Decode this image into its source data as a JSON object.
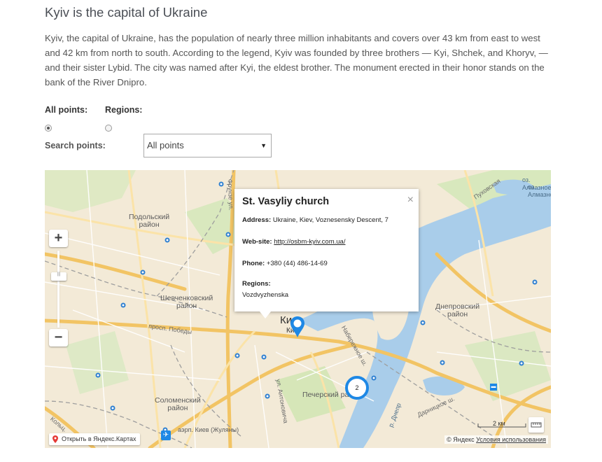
{
  "page": {
    "title": "Kyiv is the capital of Ukraine",
    "intro": "Kyiv, the capital of Ukraine, has the population of nearly three million inhabitants and covers over 43 km from east to west and 42 km from north to south. According to the legend, Kyiv was founded by three brothers — Kyi, Shchek, and Khoryv, — and their sister Lybid. The city was named after Kyi, the eldest brother. The monument erected in their honor stands on the bank of the River Dnipro."
  },
  "filters": {
    "all_points_label": "All points:",
    "regions_label": "Regions:",
    "selected": "all_points",
    "search_label": "Search points:",
    "search_value": "All points"
  },
  "map": {
    "zoom_in": "+",
    "zoom_out": "−",
    "labels": {
      "podolsky": "Подольский\nрайон",
      "shevchenkovsky": "Шевченковский\nрайон",
      "dneprovsky": "Днепровский\nрайон",
      "pechersky": "Печерский район",
      "solomensky": "Соломенский\nрайон",
      "kyiv": "Киев",
      "kyiv_sub": "Київ",
      "airport": "аэрп. Киев (Жуляны)",
      "prosp_pobedy": "просп. Победы",
      "naberezhnoe": "Набережное ш.",
      "antonovicha": "ул. Антоновича",
      "darnitskoe": "Дарницкое ш.",
      "r_dnepr": "р. Днепр",
      "puhovskaya": "Пуховская",
      "almaznoe1": "оз. Алмазное",
      "almaznoe2": "оз. Алмазное",
      "koltsevaya": "Кольц.",
      "street_top": "Фрунзе ул."
    },
    "balloon": {
      "title": "St. Vasyliy church",
      "address_label": "Address:",
      "address": "Ukraine, Kiev, Voznesensky Descent, 7",
      "website_label": "Web-site:",
      "website": "http://osbm-kyiv.com.ua/",
      "phone_label": "Phone:",
      "phone": "+380 (44) 486-14-69",
      "regions_label": "Regions:",
      "region": "Vozdvyzhenska",
      "close": "×"
    },
    "cluster_count": "2",
    "open_in_yandex": "Открыть в Яндекс.Картах",
    "scale": "2 км",
    "copyright": "© Яндекс",
    "terms": "Условия использования",
    "colors": {
      "land": "#f3ead7",
      "water": "#a9cdea",
      "road_major": "#f6cf7a",
      "road_minor": "#ffffff",
      "marker": "#1e88e5",
      "green": "#cfe6b0"
    }
  }
}
